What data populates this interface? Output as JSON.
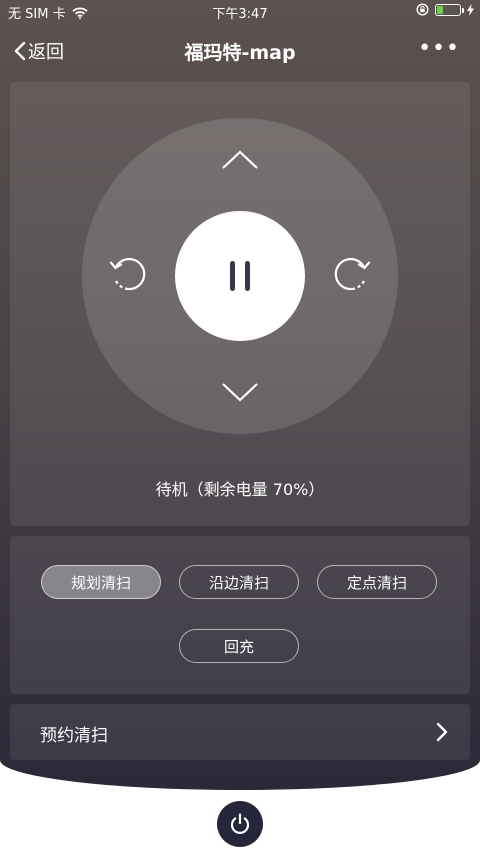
{
  "status_bar": {
    "carrier": "无 SIM 卡",
    "time": "下午3:47",
    "battery_level": 0.35
  },
  "nav": {
    "back_label": "返回",
    "title": "福玛特-map",
    "more_label": "•••"
  },
  "control": {
    "status_text": "待机（剩余电量 70%）"
  },
  "modes": {
    "items": [
      "规划清扫",
      "沿边清扫",
      "定点清扫",
      "回充"
    ],
    "selected": "规划清扫"
  },
  "schedule": {
    "label": "预约清扫"
  },
  "colors": {
    "battery_green": "#6ad14a",
    "power_button_bg": "#26263a",
    "icon_dark": "#3a3846"
  },
  "icons": [
    "wifi-icon",
    "lock-rotation-icon",
    "battery-icon",
    "charging-icon",
    "back-chevron-icon",
    "chevron-up-icon",
    "chevron-down-icon",
    "rotate-left-icon",
    "rotate-right-icon",
    "pause-icon",
    "chevron-right-icon",
    "power-icon"
  ]
}
